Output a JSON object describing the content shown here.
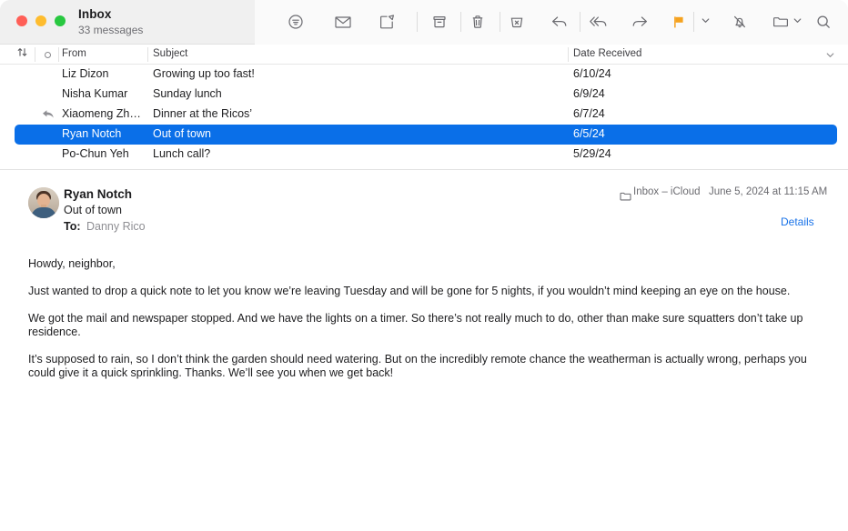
{
  "window": {
    "traffic_lights": {
      "close": "#ff5f57",
      "minimize": "#febc2e",
      "zoom": "#28c840"
    }
  },
  "header": {
    "mailbox_title": "Inbox",
    "message_count": "33 messages"
  },
  "toolbar": {
    "accent_flag_color": "#f5a21f",
    "buttons": [
      {
        "name": "filter-icon",
        "label": "Filter"
      },
      {
        "name": "mark-unread-icon",
        "label": "Mark as Unread"
      },
      {
        "name": "compose-icon",
        "label": "New Message"
      },
      {
        "name": "archive-icon",
        "label": "Archive"
      },
      {
        "name": "trash-icon",
        "label": "Delete"
      },
      {
        "name": "junk-icon",
        "label": "Move to Junk"
      },
      {
        "name": "reply-icon",
        "label": "Reply"
      },
      {
        "name": "reply-all-icon",
        "label": "Reply All"
      },
      {
        "name": "forward-icon",
        "label": "Forward"
      },
      {
        "name": "flag-icon",
        "label": "Flag"
      },
      {
        "name": "flag-dropdown-chevron-icon",
        "label": "Flag Options"
      },
      {
        "name": "mute-icon",
        "label": "Mute"
      },
      {
        "name": "move-folder-icon",
        "label": "Move To"
      },
      {
        "name": "move-folder-chevron-icon",
        "label": "Move To Options"
      },
      {
        "name": "search-icon",
        "label": "Search"
      }
    ]
  },
  "message_list": {
    "columns": {
      "sort": "Sort",
      "unread": "Unread",
      "from": "From",
      "subject": "Subject",
      "date_received": "Date Received"
    },
    "selected_row_color": "#0a6fe8",
    "rows": [
      {
        "from": "Liz Dizon",
        "subject": "Growing up too fast!",
        "date": "6/10/24",
        "selected": false,
        "replied": false
      },
      {
        "from": "Nisha Kumar",
        "subject": "Sunday lunch",
        "date": "6/9/24",
        "selected": false,
        "replied": false
      },
      {
        "from": "Xiaomeng Zh…",
        "subject": "Dinner at the Ricos’",
        "date": "6/7/24",
        "selected": false,
        "replied": true
      },
      {
        "from": "Ryan Notch",
        "subject": "Out of town",
        "date": "6/5/24",
        "selected": true,
        "replied": false
      },
      {
        "from": "Po-Chun Yeh",
        "subject": "Lunch call?",
        "date": "5/29/24",
        "selected": false,
        "replied": false
      }
    ]
  },
  "reading_pane": {
    "sender_name": "Ryan Notch",
    "subject": "Out of town",
    "to_label": "To:",
    "to_value": "Danny Rico",
    "mailbox": "Inbox – iCloud",
    "datetime": "June 5, 2024 at 11:15 AM",
    "details_link": "Details",
    "details_link_color": "#1a73e8",
    "body_paragraphs": [
      "Howdy, neighbor,",
      "Just wanted to drop a quick note to let you know we’re leaving Tuesday and will be gone for 5 nights, if you wouldn’t mind keeping an eye on the house.",
      "We got the mail and newspaper stopped. And we have the lights on a timer. So there’s not really much to do, other than make sure squatters don’t take up residence.",
      "It’s supposed to rain, so I don’t think the garden should need watering. But on the incredibly remote chance the weatherman is actually wrong, perhaps you could give it a quick sprinkling. Thanks. We’ll see you when we get back!"
    ]
  }
}
